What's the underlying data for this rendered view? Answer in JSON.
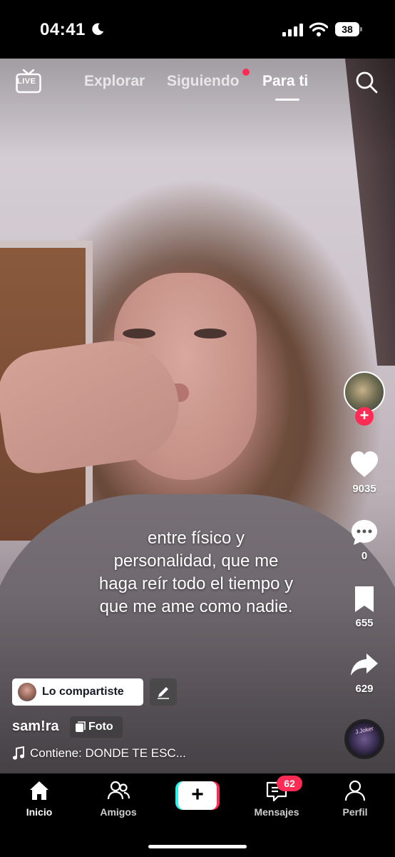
{
  "status_bar": {
    "time": "04:41",
    "battery": "38",
    "moon_icon": "moon-icon",
    "signal_icon": "cellular-signal-icon",
    "wifi_icon": "wifi-icon"
  },
  "top_nav": {
    "live_label": "LIVE",
    "tabs": [
      {
        "label": "Explorar",
        "active": false
      },
      {
        "label": "Siguiendo",
        "active": false,
        "has_notification": true
      },
      {
        "label": "Para ti",
        "active": true
      }
    ],
    "search_icon": "search-icon"
  },
  "caption": {
    "lines": [
      "entre físico y",
      "personalidad, que me",
      "haga reír todo el tiempo y",
      "que me ame como nadie."
    ]
  },
  "right_rail": {
    "follow_symbol": "+",
    "likes": "9035",
    "comments": "0",
    "saves": "655",
    "shares": "629",
    "disc_text": "J.Joker",
    "accent_color": "#fe2c55"
  },
  "post_info": {
    "shared_label": "Lo compartiste",
    "username": "sam!ra",
    "photo_label": "Foto",
    "music_label": "Contiene: DONDE TE ESC..."
  },
  "tab_bar": {
    "items": [
      {
        "label": "Inicio",
        "icon": "home-icon",
        "active": true
      },
      {
        "label": "Amigos",
        "icon": "friends-icon",
        "active": false
      },
      {
        "label": "",
        "icon": "create-icon",
        "active": false
      },
      {
        "label": "Mensajes",
        "icon": "inbox-icon",
        "active": false
      },
      {
        "label": "Perfil",
        "icon": "profile-icon",
        "active": false
      }
    ],
    "create_symbol": "+",
    "messages_badge": "62"
  }
}
